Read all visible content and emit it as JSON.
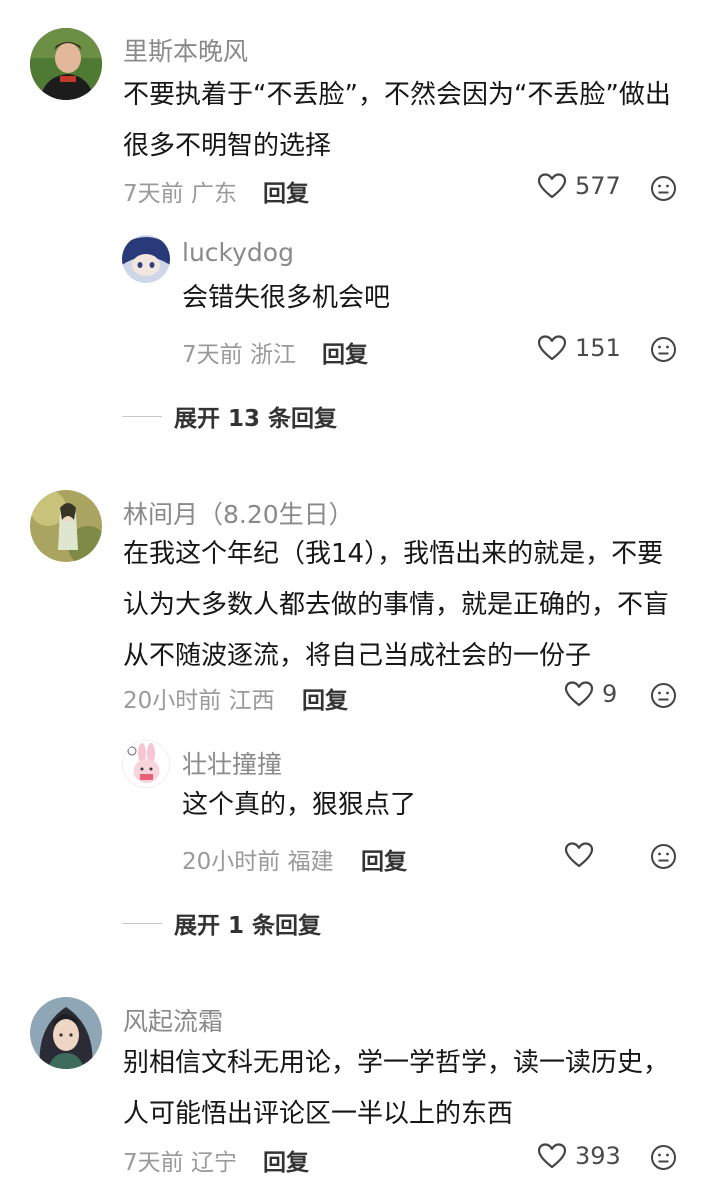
{
  "comments": [
    {
      "user": "里斯本晚风",
      "text": "不要执着于“不丢脸”，不然会因为“不丢脸”做出很多不明智的选择",
      "time_loc": "7天前 广东",
      "reply_label": "回复",
      "likes": "577",
      "replies": [
        {
          "user": "luckydog",
          "text": "会错失很多机会吧",
          "time_loc": "7天前 浙江",
          "reply_label": "回复",
          "likes": "151"
        }
      ],
      "expand_label": "展开 13 条回复"
    },
    {
      "user": "林间月（8.20生日）",
      "text": "在我这个年纪（我14），我悟出来的就是，不要认为大多数人都去做的事情，就是正确的，不盲从不随波逐流，将自己当成社会的一份子",
      "time_loc": "20小时前 江西",
      "reply_label": "回复",
      "likes": "9",
      "replies": [
        {
          "user": "壮壮撞撞",
          "text": "这个真的，狠狠点了",
          "time_loc": "20小时前 福建",
          "reply_label": "回复",
          "likes": ""
        }
      ],
      "expand_label": "展开 1 条回复"
    },
    {
      "user": "风起流霜",
      "text": "别相信文科无用论，学一学哲学，读一读历史，人可能悟出评论区一半以上的东西",
      "time_loc": "7天前 辽宁",
      "reply_label": "回复",
      "likes": "393"
    }
  ],
  "icons": {
    "like": "heart-outline-icon",
    "dislike": "neutral-face-icon"
  }
}
